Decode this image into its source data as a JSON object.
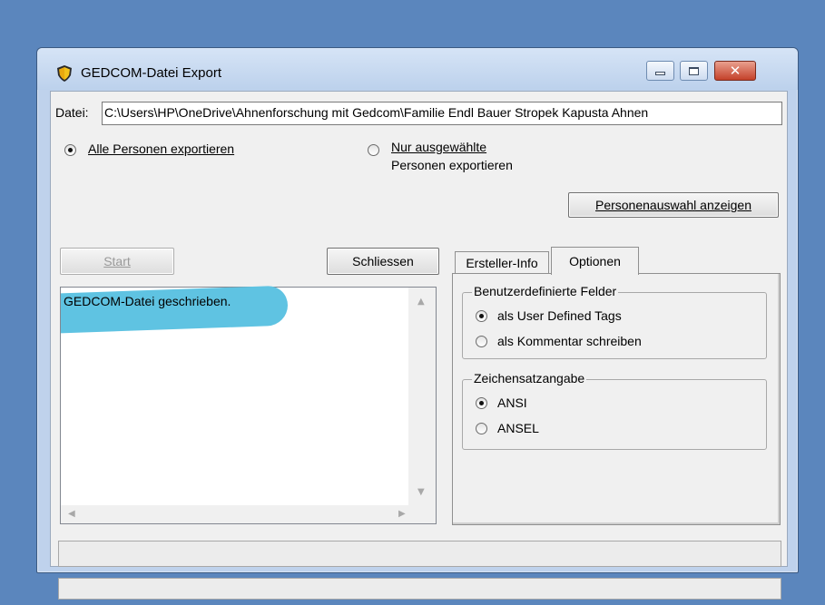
{
  "window": {
    "title": "GEDCOM-Datei Export"
  },
  "file": {
    "label": "Datei:",
    "value": "C:\\Users\\HP\\OneDrive\\Ahnenforschung mit Gedcom\\Familie Endl Bauer Stropek Kapusta Ahnen"
  },
  "export_scope": {
    "all_label": "Alle Personen exportieren",
    "selected_line1": "Nur ausgewählte",
    "selected_line2": "Personen exportieren",
    "selected_value": "all"
  },
  "buttons": {
    "show_selection": "Personenauswahl anzeigen",
    "start": "Start",
    "close": "Schliessen"
  },
  "log": {
    "lines": [
      "GEDCOM-Datei geschrieben."
    ]
  },
  "tabs": {
    "items": [
      "Ersteller-Info",
      "Optionen"
    ],
    "active": "Optionen"
  },
  "options": {
    "custom_fields": {
      "title": "Benutzerdefinierte Felder",
      "opt1": "als User Defined Tags",
      "opt2": "als Kommentar schreiben",
      "selected": "als User Defined Tags"
    },
    "charset": {
      "title": "Zeichensatzangabe",
      "opt1": "ANSI",
      "opt2": "ANSEL",
      "selected": "ANSI"
    }
  },
  "colors": {
    "desktop": "#5b86bd",
    "highlight": "#5fc3e2",
    "close_button": "#c4412a"
  }
}
